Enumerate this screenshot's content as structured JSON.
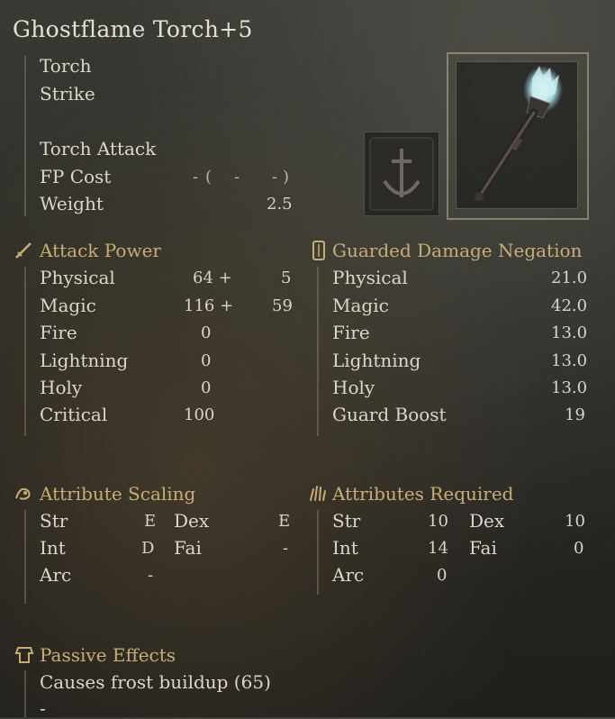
{
  "weapon": {
    "name": "Ghostflame Torch+5",
    "type": "Torch",
    "attack_type": "Strike",
    "skill": "Torch Attack",
    "fp_cost": {
      "label": "FP Cost",
      "parts": [
        "-",
        "(",
        "-",
        "-",
        ")"
      ]
    },
    "weight": {
      "label": "Weight",
      "value": "2.5"
    }
  },
  "attack_power": {
    "title": "Attack Power",
    "rows": [
      {
        "label": "Physical",
        "base": "64 +",
        "bonus": "5"
      },
      {
        "label": "Magic",
        "base": "116 +",
        "bonus": "59"
      },
      {
        "label": "Fire",
        "base": "0",
        "bonus": ""
      },
      {
        "label": "Lightning",
        "base": "0",
        "bonus": ""
      },
      {
        "label": "Holy",
        "base": "0",
        "bonus": ""
      },
      {
        "label": "Critical",
        "base": "100",
        "bonus": ""
      }
    ]
  },
  "guarded_negation": {
    "title": "Guarded Damage Negation",
    "rows": [
      {
        "label": "Physical",
        "value": "21.0"
      },
      {
        "label": "Magic",
        "value": "42.0"
      },
      {
        "label": "Fire",
        "value": "13.0"
      },
      {
        "label": "Lightning",
        "value": "13.0"
      },
      {
        "label": "Holy",
        "value": "13.0"
      },
      {
        "label": "Guard Boost",
        "value": "19"
      }
    ]
  },
  "attribute_scaling": {
    "title": "Attribute Scaling",
    "str": {
      "label": "Str",
      "value": "E"
    },
    "dex": {
      "label": "Dex",
      "value": "E"
    },
    "int": {
      "label": "Int",
      "value": "D"
    },
    "fai": {
      "label": "Fai",
      "value": "-"
    },
    "arc": {
      "label": "Arc",
      "value": "-"
    }
  },
  "attributes_required": {
    "title": "Attributes Required",
    "str": {
      "label": "Str",
      "value": "10"
    },
    "dex": {
      "label": "Dex",
      "value": "10"
    },
    "int": {
      "label": "Int",
      "value": "14"
    },
    "fai": {
      "label": "Fai",
      "value": "0"
    },
    "arc": {
      "label": "Arc",
      "value": "0"
    }
  },
  "passive_effects": {
    "title": "Passive Effects",
    "effect1": "Causes frost buildup (65)",
    "effect2": "-"
  },
  "icons": {
    "attack_power": "sword-icon",
    "guarded_negation": "shield-icon",
    "attribute_scaling": "arm-icon",
    "attributes_required": "hand-icon",
    "passive_effects": "armor-icon",
    "weapon_image": "ghostflame-torch-icon",
    "ash_of_war": "ash-of-war-sword-icon"
  },
  "colors": {
    "header_gold": "#c9ae74",
    "text": "#dcd7c9",
    "flame": "#bfe8ea"
  }
}
